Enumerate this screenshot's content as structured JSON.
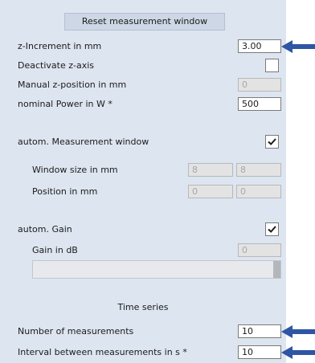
{
  "reset_button": {
    "label": "Reset measurement window"
  },
  "z_increment": {
    "label": "z-Increment in mm",
    "value": "3.00"
  },
  "deactivate_z": {
    "label": "Deactivate z-axis",
    "checked": false
  },
  "manual_z": {
    "label": "Manual z-position in mm",
    "value": "0",
    "enabled": false
  },
  "nominal_power": {
    "label": "nominal Power in W *",
    "value": "500"
  },
  "auto_window": {
    "label": "autom. Measurement window",
    "checked": true
  },
  "window_size": {
    "label": "Window size in mm",
    "value_x": "8",
    "value_y": "8",
    "enabled": false
  },
  "position": {
    "label": "Position in mm",
    "value_x": "0",
    "value_y": "0",
    "enabled": false
  },
  "auto_gain": {
    "label": "autom. Gain",
    "checked": true
  },
  "gain": {
    "label": "Gain in dB",
    "value": "0",
    "enabled": false
  },
  "time_series": {
    "title": "Time series",
    "num_measurements": {
      "label": "Number of measurements",
      "value": "10"
    },
    "interval": {
      "label": "Interval between measurements in s *",
      "value": "10"
    }
  },
  "colors": {
    "panel_bg": "#dde5f0",
    "arrow": "#2f55a4",
    "button_bg": "#cdd7e5"
  },
  "icons": {
    "check": "check-mark",
    "arrow": "blue-callout-arrow"
  }
}
